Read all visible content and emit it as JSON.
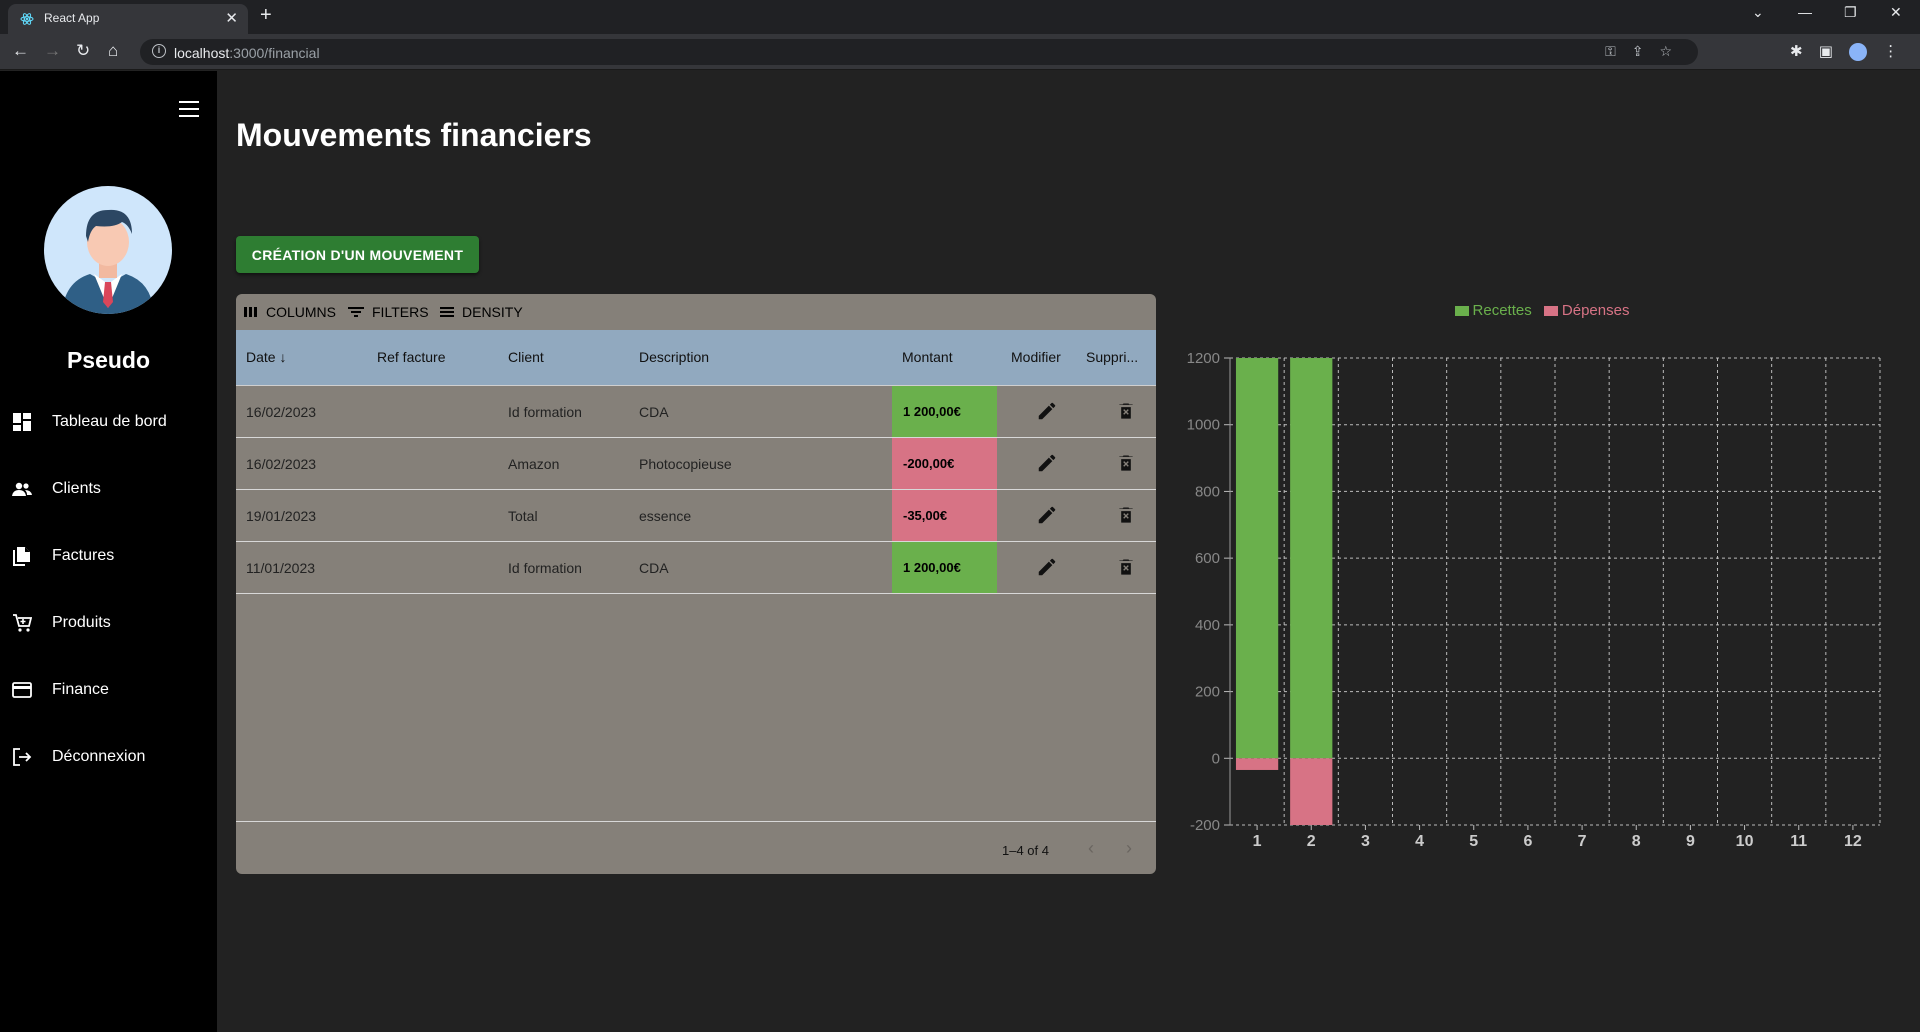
{
  "browser": {
    "tab_title": "React App",
    "url_host": "localhost",
    "url_path": ":3000/financial"
  },
  "sidebar": {
    "username": "Pseudo",
    "items": [
      {
        "label": "Tableau de bord",
        "icon": "dashboard-icon"
      },
      {
        "label": "Clients",
        "icon": "people-icon"
      },
      {
        "label": "Factures",
        "icon": "documents-icon"
      },
      {
        "label": "Produits",
        "icon": "cart-icon"
      },
      {
        "label": "Finance",
        "icon": "credit-card-icon"
      },
      {
        "label": "Déconnexion",
        "icon": "logout-icon"
      }
    ]
  },
  "page": {
    "title": "Mouvements financiers",
    "create_button": "CRÉATION D'UN MOUVEMENT"
  },
  "grid": {
    "toolbar": {
      "columns": "COLUMNS",
      "filters": "FILTERS",
      "density": "DENSITY"
    },
    "headers": {
      "date": "Date",
      "ref": "Ref facture",
      "client": "Client",
      "description": "Description",
      "amount": "Montant",
      "edit": "Modifier",
      "delete": "Suppri..."
    },
    "rows": [
      {
        "date": "16/02/2023",
        "ref": "",
        "client": "Id formation",
        "description": "CDA",
        "amount": "1 200,00€",
        "sign": "pos"
      },
      {
        "date": "16/02/2023",
        "ref": "",
        "client": "Amazon",
        "description": "Photocopieuse",
        "amount": "-200,00€",
        "sign": "neg"
      },
      {
        "date": "19/01/2023",
        "ref": "",
        "client": "Total",
        "description": "essence",
        "amount": "-35,00€",
        "sign": "neg"
      },
      {
        "date": "11/01/2023",
        "ref": "",
        "client": "Id formation",
        "description": "CDA",
        "amount": "1 200,00€",
        "sign": "pos"
      }
    ],
    "pagination": "1–4 of 4"
  },
  "colors": {
    "recettes": "#6ab04c",
    "depenses": "#d77385",
    "create_button": "#2e7d32",
    "header": "#91a9bf"
  },
  "chart_data": {
    "type": "bar",
    "stacked": true,
    "categories": [
      "1",
      "2",
      "3",
      "4",
      "5",
      "6",
      "7",
      "8",
      "9",
      "10",
      "11",
      "12"
    ],
    "series": [
      {
        "name": "Recettes",
        "values": [
          1200,
          1200,
          0,
          0,
          0,
          0,
          0,
          0,
          0,
          0,
          0,
          0
        ]
      },
      {
        "name": "Dépenses",
        "values": [
          -35,
          -200,
          0,
          0,
          0,
          0,
          0,
          0,
          0,
          0,
          0,
          0
        ]
      }
    ],
    "yticks": [
      "-200",
      "0",
      "200",
      "400",
      "600",
      "800",
      "1000",
      "1200"
    ],
    "ylim": [
      -200,
      1200
    ],
    "grid": true,
    "legend": "top-center"
  }
}
